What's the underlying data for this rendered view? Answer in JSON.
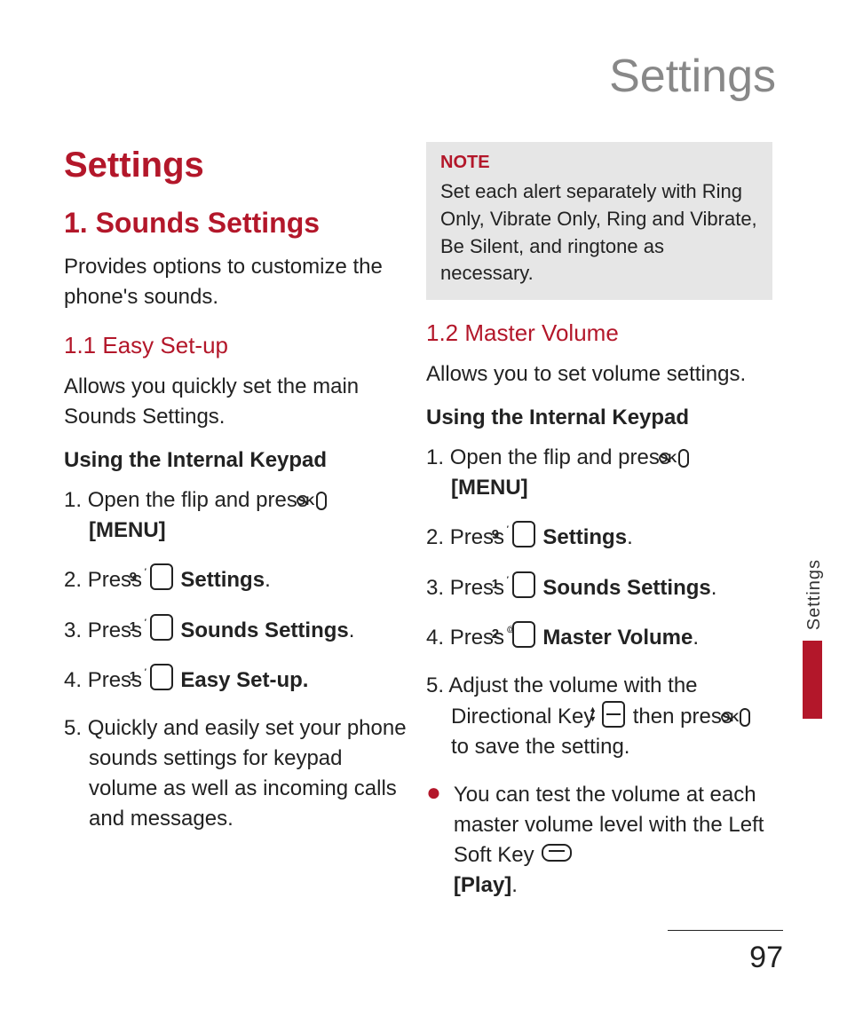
{
  "page_heading": "Settings",
  "side_tab_label": "Settings",
  "page_number": "97",
  "left": {
    "h_settings": "Settings",
    "h_section": "1. Sounds Settings",
    "intro": "Provides options to customize the phone's sounds.",
    "sub1_heading": "1.1 Easy Set-up",
    "sub1_intro": "Allows you quickly set the main Sounds Settings.",
    "keypad_heading": "Using the Internal Keypad",
    "steps": {
      "s1a": "Open the flip and press ",
      "s1b": "[MENU]",
      "s2a": "Press ",
      "s2b": "Settings",
      "s3a": "Press ",
      "s3b": "Sounds Settings",
      "s4a": "Press ",
      "s4b": "Easy Set-up.",
      "s5": "Quickly and easily set your phone sounds settings for keypad volume as well as incoming calls and messages."
    }
  },
  "right": {
    "note_label": "NOTE",
    "note_text": "Set each alert separately with Ring Only, Vibrate Only, Ring and Vibrate, Be Silent, and ringtone as necessary.",
    "sub2_heading": "1.2 Master Volume",
    "sub2_intro": "Allows you to set volume settings.",
    "keypad_heading": "Using the Internal Keypad",
    "steps": {
      "s1a": "Open the flip and press ",
      "s1b": "[MENU]",
      "s2a": "Press ",
      "s2b": "Settings",
      "s3a": "Press ",
      "s3b": "Sounds Settings",
      "s4a": "Press ",
      "s4b": "Master Volume",
      "s5a": "Adjust the volume with the Directional Key ",
      "s5b": " then press ",
      "s5c": " to save the setting."
    },
    "bullet_a": "You can test the volume at each master volume level with the Left Soft Key ",
    "bullet_b": "[Play]"
  },
  "icons": {
    "ok": "OK",
    "key9": {
      "n": "9",
      "sup": "′"
    },
    "key1": {
      "n": "1",
      "sup": "′"
    },
    "key2": {
      "n": "2",
      "sup": "@"
    }
  }
}
